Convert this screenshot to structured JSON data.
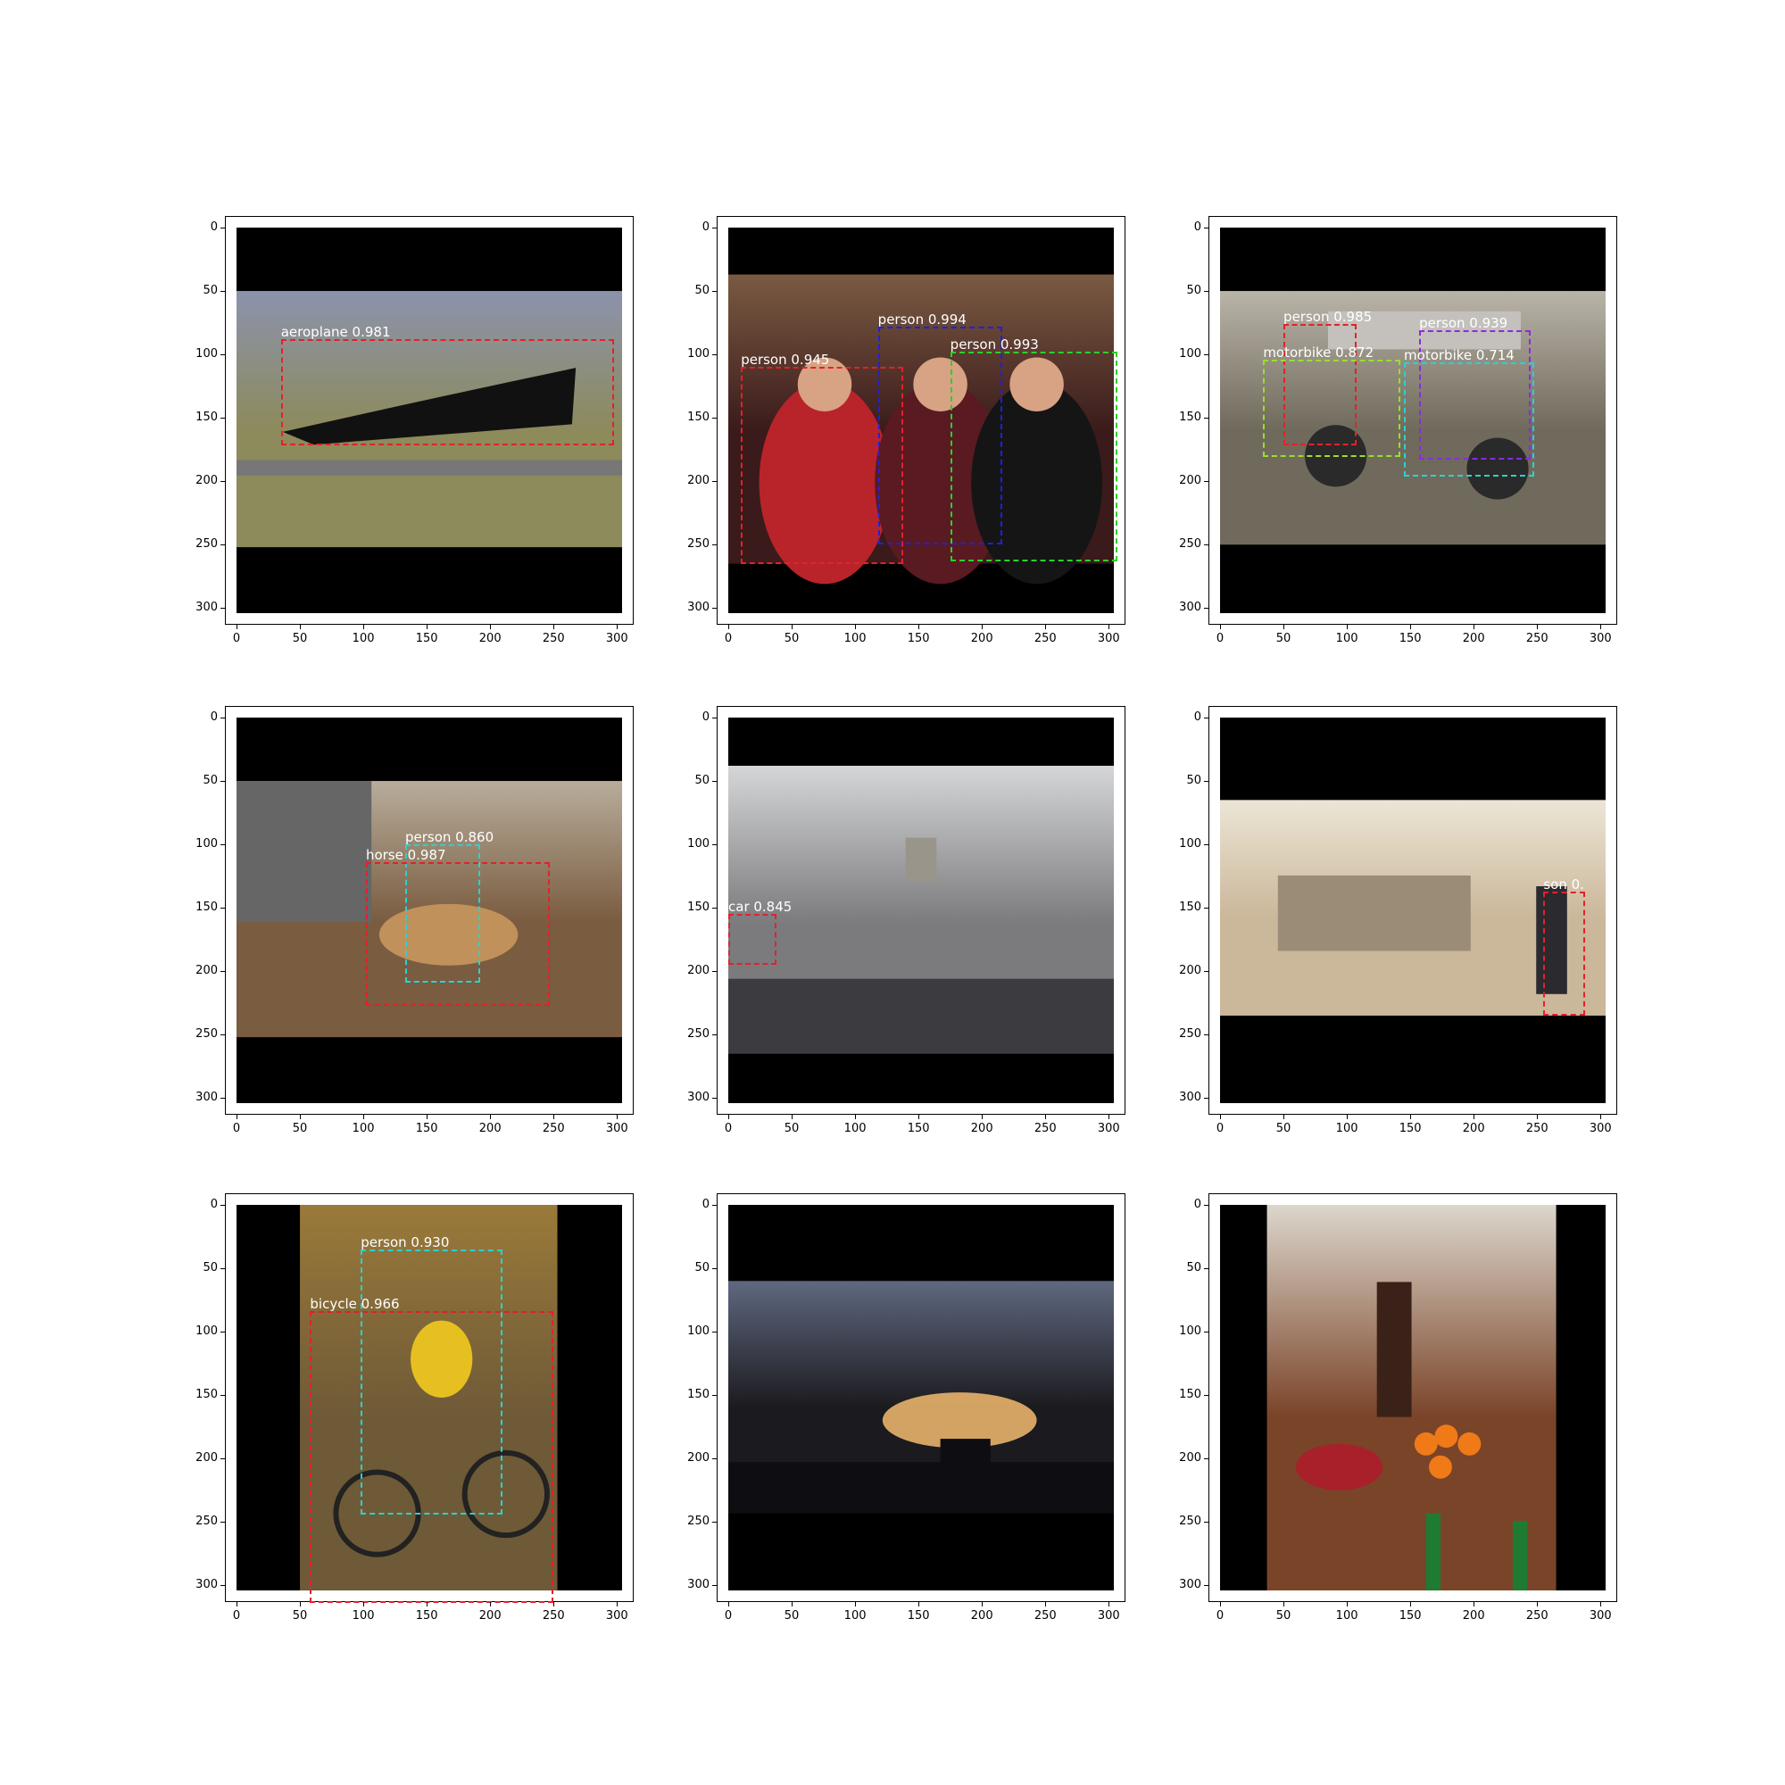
{
  "axes": {
    "ticks": [
      "0",
      "50",
      "100",
      "150",
      "200",
      "250",
      "300"
    ],
    "tick_values": [
      0,
      50,
      100,
      150,
      200,
      250,
      300
    ],
    "range": [
      0,
      304
    ]
  },
  "panels": [
    {
      "scene": "jet-airplane-on-runway",
      "image_band": [
        50,
        252
      ],
      "image_cols": [
        0,
        304
      ],
      "palette": {
        "sky": "#8b93ad",
        "ground": "#8d8a5b",
        "object": "#111111"
      },
      "detections": [
        {
          "label": "aeroplane 0.981",
          "box": [
            35,
            88,
            298,
            172
          ],
          "color": "#e3212a"
        }
      ]
    },
    {
      "scene": "three-women-posing",
      "image_band": [
        37,
        265
      ],
      "image_cols": [
        0,
        304
      ],
      "palette": {
        "sky": "#7a5a42",
        "ground": "#3a1a1a",
        "object": "#a8282a"
      },
      "detections": [
        {
          "label": "person 0.945",
          "box": [
            10,
            110,
            138,
            265
          ],
          "color": "#e3212a"
        },
        {
          "label": "person 0.994",
          "box": [
            118,
            78,
            216,
            250
          ],
          "color": "#1f1fe3"
        },
        {
          "label": "person 0.993",
          "box": [
            175,
            98,
            307,
            263
          ],
          "color": "#2bd12b"
        }
      ]
    },
    {
      "scene": "motocross-riders",
      "image_band": [
        50,
        250
      ],
      "image_cols": [
        0,
        304
      ],
      "palette": {
        "sky": "#b9b4a8",
        "ground": "#706a5c",
        "object": "#c4c0bc"
      },
      "detections": [
        {
          "label": "person 0.985",
          "box": [
            50,
            76,
            108,
            172
          ],
          "color": "#e3212a"
        },
        {
          "label": "person 0.939",
          "box": [
            157,
            81,
            245,
            183
          ],
          "color": "#8a2be2"
        },
        {
          "label": "motorbike 0.872",
          "box": [
            34,
            104,
            142,
            181
          ],
          "color": "#9adf2a"
        },
        {
          "label": "motorbike 0.714",
          "box": [
            145,
            106,
            248,
            196
          ],
          "color": "#2ad1d1"
        }
      ]
    },
    {
      "scene": "person-leading-horse",
      "image_band": [
        50,
        252
      ],
      "image_cols": [
        0,
        304
      ],
      "palette": {
        "sky": "#b7ad9b",
        "ground": "#7a5c40",
        "object": "#c0915a"
      },
      "detections": [
        {
          "label": "person 0.860",
          "box": [
            133,
            100,
            192,
            209
          ],
          "color": "#2ad1d1"
        },
        {
          "label": "horse 0.987",
          "box": [
            102,
            114,
            247,
            227
          ],
          "color": "#e3212a"
        }
      ]
    },
    {
      "scene": "street-avenue-from-car",
      "image_band": [
        38,
        265
      ],
      "image_cols": [
        0,
        304
      ],
      "palette": {
        "sky": "#d5d6d7",
        "ground": "#7b7b7e",
        "object": "#9aa1ab"
      },
      "detections": [
        {
          "label": "car 0.845",
          "box": [
            0,
            155,
            38,
            195
          ],
          "color": "#e3212a"
        }
      ]
    },
    {
      "scene": "office-interior-from-above",
      "image_band": [
        65,
        235
      ],
      "image_cols": [
        0,
        304
      ],
      "palette": {
        "sky": "#ece5d6",
        "ground": "#cbb79a",
        "object": "#2b2b2b"
      },
      "detections": [
        {
          "label": "son 0.",
          "box": [
            255,
            137,
            288,
            235
          ],
          "color": "#e3212a"
        }
      ]
    },
    {
      "scene": "child-on-bicycle",
      "image_band": [
        0,
        304
      ],
      "image_cols": [
        50,
        253
      ],
      "palette": {
        "sky": "#9a7a3a",
        "ground": "#6f5a37",
        "object": "#e6c020"
      },
      "detections": [
        {
          "label": "person 0.930",
          "box": [
            98,
            35,
            210,
            244
          ],
          "color": "#2ad1d1"
        },
        {
          "label": "bicycle 0.966",
          "box": [
            58,
            84,
            250,
            314
          ],
          "color": "#e3212a"
        }
      ]
    },
    {
      "scene": "cow-silhouette-at-sunset",
      "image_band": [
        60,
        243
      ],
      "image_cols": [
        0,
        304
      ],
      "palette": {
        "sky": "#5f6880",
        "ground": "#1b1a1e",
        "object": "#e8b26a"
      },
      "detections": []
    },
    {
      "scene": "chocolate-fountain-fruit-table",
      "image_band": [
        0,
        304
      ],
      "image_cols": [
        37,
        265
      ],
      "palette": {
        "sky": "#dcd6cc",
        "ground": "#7a4428",
        "object": "#f07a18"
      },
      "detections": []
    }
  ]
}
